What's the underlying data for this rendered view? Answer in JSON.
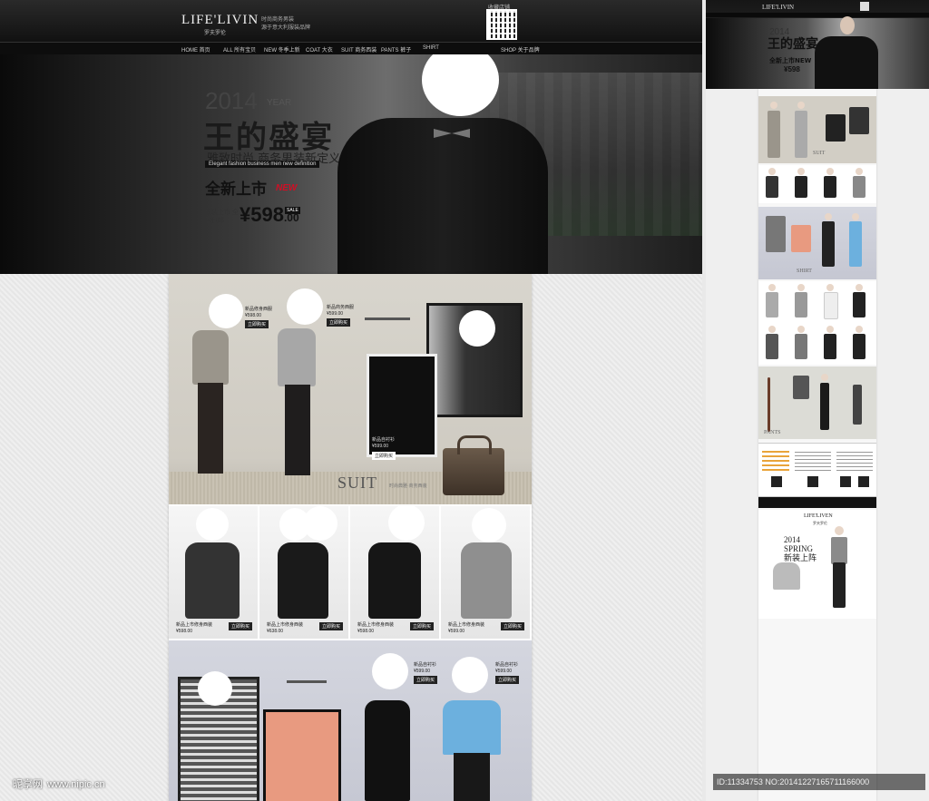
{
  "brand": {
    "logo": "LIFE'LIVIN",
    "logo_sub": "罗夫罗伦",
    "slogan_line1": "时尚商务男装",
    "slogan_line2": "源于意大利服装品牌",
    "qr_label": "收藏店铺"
  },
  "nav": [
    "HOME 首页",
    "ALL 所有宝贝",
    "NEW 冬季上新",
    "COAT 大衣",
    "SUIT 商务西装",
    "PANTS 裤子",
    "SHIRT",
    "SHOP 关于品牌"
  ],
  "hero": {
    "year": "2014",
    "year_word": "YEAR",
    "title": "王的盛宴",
    "subtitle": "雅致时尚  商务男装新定义",
    "subtitle_en": "Elegant fashion business men new definition",
    "new_label": "全新上市",
    "new_tag": "NEW",
    "note": "新装上市 全国包邮",
    "price": "¥598.00",
    "price_main": "598",
    "price_dec": ".00",
    "sale_tag": "SALE"
  },
  "suit_section": {
    "word": "SUIT",
    "word_cn": "时尚典雅·商务西装",
    "items": [
      {
        "name": "新品修身西服",
        "price": "¥598.00",
        "buy": "立即购买"
      },
      {
        "name": "新品商务西服",
        "price": "¥599.00",
        "buy": "立即购买"
      },
      {
        "name": "新品自衬衫",
        "price": "¥599.00",
        "buy": "立即购买"
      }
    ]
  },
  "product_row": [
    {
      "name": "新品上市修身西装",
      "price": "¥598.00",
      "buy": "立即购买"
    },
    {
      "name": "新品上市修身西装",
      "price": "¥638.00",
      "buy": "立即购买"
    },
    {
      "name": "新品上市修身西装",
      "price": "¥598.00",
      "buy": "立即购买"
    },
    {
      "name": "新品上市修身西装",
      "price": "¥599.00",
      "buy": "立即购买"
    }
  ],
  "shirt_section": {
    "items": [
      {
        "name": "新品自衬衫",
        "price": "¥599.00",
        "buy": "立即购买"
      },
      {
        "name": "新品自衬衫",
        "price": "¥599.00",
        "buy": "立即购买"
      }
    ]
  },
  "preview": {
    "logo": "LIFE'LIVIN",
    "hero_year": "2014",
    "hero_title": "王的盛宴",
    "hero_new": "全新上市NEW",
    "hero_price": "¥598",
    "label_suit": "SUIT",
    "label_shirt": "SHIRT",
    "label_pants": "PANTS",
    "bottom_logo": "LIFE'LIVEN",
    "bottom_logo_sub": "罗夫罗伦",
    "spring_year": "2014",
    "spring_word": "SPRING",
    "spring_cn": "新装上阵"
  },
  "watermark": {
    "site": "昵享网",
    "url": "www.nipic.cn",
    "id_text": "ID:11334753 NO:20141227165711166000"
  }
}
